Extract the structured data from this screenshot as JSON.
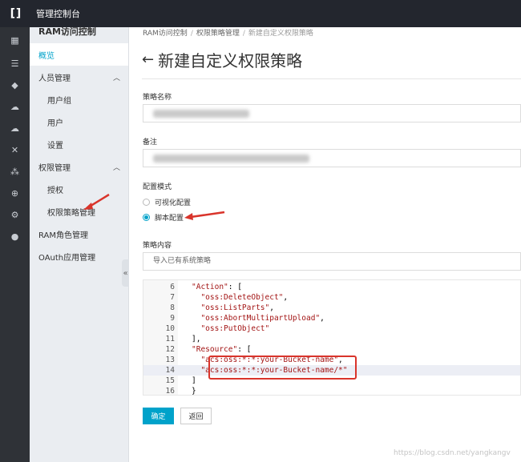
{
  "topbar": {
    "title": "管理控制台"
  },
  "rail": {
    "icons": [
      "grid-icon",
      "list-icon",
      "diamond-icon",
      "cloud-icon",
      "cloud-upload-icon",
      "cross-icon",
      "nodes-icon",
      "globe-icon",
      "gear-icon",
      "dot-icon"
    ]
  },
  "menu": {
    "title": "RAM访问控制",
    "overview": "概览",
    "people": "人员管理",
    "usergroup": "用户组",
    "user": "用户",
    "settings": "设置",
    "perm": "权限管理",
    "grant": "授权",
    "policy": "权限策略管理",
    "role": "RAM角色管理",
    "oauth": "OAuth应用管理",
    "collapse": "«"
  },
  "breadcrumb": {
    "a": "RAM访问控制",
    "b": "权限策略管理",
    "c": "新建自定义权限策略"
  },
  "page": {
    "title": "新建自定义权限策略"
  },
  "form": {
    "name_label": "策略名称",
    "note_label": "备注",
    "mode_label": "配置模式",
    "mode_visual": "可视化配置",
    "mode_script": "脚本配置",
    "content_label": "策略内容",
    "import_placeholder": "导入已有系统策略"
  },
  "code": [
    {
      "n": "6",
      "t": "\"Action\": ["
    },
    {
      "n": "7",
      "t": "  \"oss:DeleteObject\","
    },
    {
      "n": "8",
      "t": "  \"oss:ListParts\","
    },
    {
      "n": "9",
      "t": "  \"oss:AbortMultipartUpload\","
    },
    {
      "n": "10",
      "t": "  \"oss:PutObject\""
    },
    {
      "n": "11",
      "t": "],"
    },
    {
      "n": "12",
      "t": "\"Resource\": ["
    },
    {
      "n": "13",
      "t": "  \"acs:oss:*:*:your-Bucket-name\","
    },
    {
      "n": "14",
      "t": "  \"acs:oss:*:*:your-Bucket-name/*\""
    },
    {
      "n": "15",
      "t": "]"
    },
    {
      "n": "16",
      "t": "}"
    }
  ],
  "buttons": {
    "ok": "确定",
    "back": "返回"
  },
  "watermark": "https://blog.csdn.net/yangkangv",
  "colors": {
    "accent": "#00a2ca",
    "annotation": "#d9342b",
    "topbar": "#23262e"
  }
}
